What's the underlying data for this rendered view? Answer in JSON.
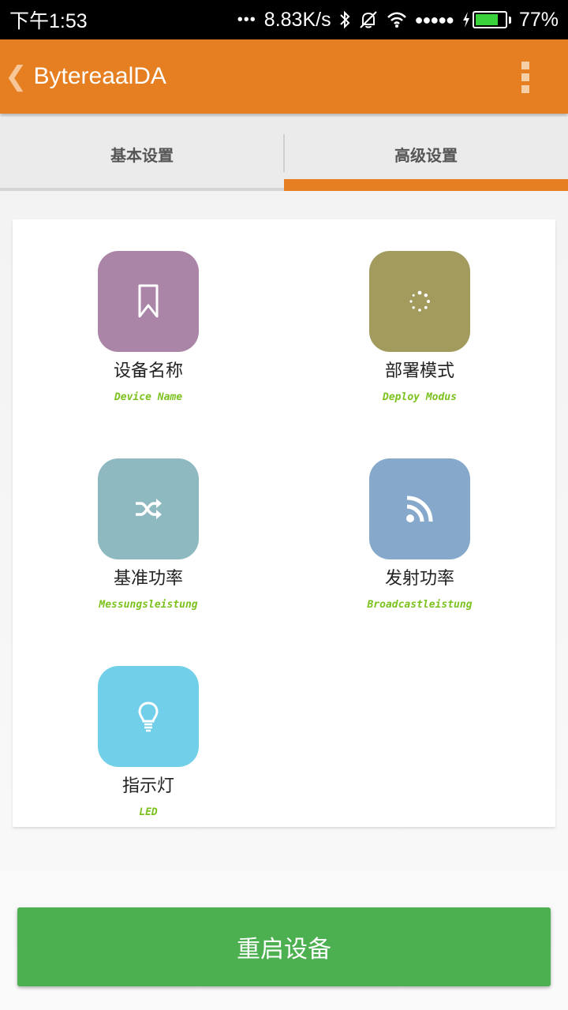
{
  "status_bar": {
    "time": "下午1:53",
    "dots": "•••",
    "network_speed": "8.83K/s",
    "signal_dots": "●●●●●",
    "battery_percent": "77%",
    "battery_level": 0.77,
    "icons": [
      "bluetooth-icon",
      "mute-vibrate-icon",
      "wifi-icon",
      "signal-icon",
      "charging-icon",
      "battery-icon"
    ]
  },
  "app_bar": {
    "back_icon": "❮",
    "title": "BytereaalDA",
    "overflow_icon": "more-vertical-icon"
  },
  "tabs": [
    {
      "label": "基本设置",
      "active": false
    },
    {
      "label": "高级设置",
      "active": true
    }
  ],
  "settings": [
    {
      "label": "设备名称",
      "sublabel": "Device Name",
      "icon": "bookmark-icon",
      "color": "#ab85a8"
    },
    {
      "label": "部署模式",
      "sublabel": "Deploy Modus",
      "icon": "spinner-icon",
      "color": "#a39b5e"
    },
    {
      "label": "基准功率",
      "sublabel": "Messungsleistung",
      "icon": "shuffle-icon",
      "color": "#8fb9c0"
    },
    {
      "label": "发射功率",
      "sublabel": "Broadcastleistung",
      "icon": "rss-icon",
      "color": "#86a9cb"
    },
    {
      "label": "指示灯",
      "sublabel": "LED",
      "icon": "lightbulb-icon",
      "color": "#72cfea"
    }
  ],
  "actions": {
    "reboot_label": "重启设备",
    "reboot_color": "#4caf50"
  },
  "colors": {
    "accent": "#e67f22"
  }
}
